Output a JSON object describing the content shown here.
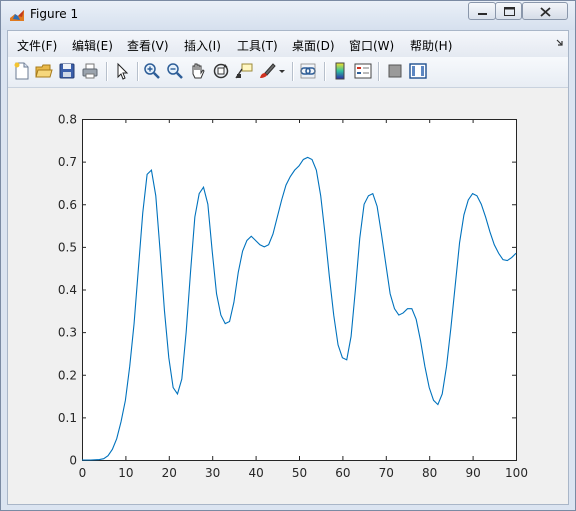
{
  "window": {
    "title": "Figure 1",
    "icon": "matlab-figure-icon",
    "controls": [
      "minimize-icon",
      "maximize-icon",
      "close-icon"
    ]
  },
  "menu": [
    {
      "label": "文件(F)"
    },
    {
      "label": "编辑(E)"
    },
    {
      "label": "查看(V)"
    },
    {
      "label": "插入(I)"
    },
    {
      "label": "工具(T)"
    },
    {
      "label": "桌面(D)"
    },
    {
      "label": "窗口(W)"
    },
    {
      "label": "帮助(H)"
    }
  ],
  "toolbar": [
    "new-figure-icon",
    "open-file-icon",
    "save-icon",
    "print-icon",
    "edit-plot-arrow-icon",
    "zoom-in-icon",
    "zoom-out-icon",
    "pan-hand-icon",
    "rotate-3d-icon",
    "data-cursor-icon",
    "brush-icon",
    "brush-dropdown-icon",
    "link-plot-icon",
    "insert-colorbar-icon",
    "insert-legend-icon",
    "hide-plot-tools-icon",
    "show-plot-tools-icon"
  ],
  "chart_data": {
    "type": "line",
    "title": "",
    "xlabel": "",
    "ylabel": "",
    "xlim": [
      0,
      100
    ],
    "ylim": [
      0,
      0.8
    ],
    "xticks": [
      "0",
      "10",
      "20",
      "30",
      "40",
      "50",
      "60",
      "70",
      "80",
      "90",
      "100"
    ],
    "yticks": [
      "0",
      "0.1",
      "0.2",
      "0.3",
      "0.4",
      "0.5",
      "0.6",
      "0.7",
      "0.8"
    ],
    "grid": false,
    "line_color": "#0072bd",
    "series": [
      {
        "values": [
          [
            0,
            0
          ],
          [
            2,
            0
          ],
          [
            4,
            0.001
          ],
          [
            5,
            0.003
          ],
          [
            6,
            0.01
          ],
          [
            7,
            0.025
          ],
          [
            8,
            0.05
          ],
          [
            9,
            0.09
          ],
          [
            10,
            0.14
          ],
          [
            11,
            0.22
          ],
          [
            12,
            0.32
          ],
          [
            13,
            0.45
          ],
          [
            14,
            0.58
          ],
          [
            15,
            0.67
          ],
          [
            16,
            0.68
          ],
          [
            17,
            0.62
          ],
          [
            18,
            0.49
          ],
          [
            19,
            0.35
          ],
          [
            20,
            0.24
          ],
          [
            21,
            0.17
          ],
          [
            22,
            0.155
          ],
          [
            23,
            0.19
          ],
          [
            24,
            0.3
          ],
          [
            25,
            0.44
          ],
          [
            26,
            0.57
          ],
          [
            27,
            0.625
          ],
          [
            28,
            0.64
          ],
          [
            29,
            0.6
          ],
          [
            30,
            0.49
          ],
          [
            31,
            0.39
          ],
          [
            32,
            0.34
          ],
          [
            33,
            0.32
          ],
          [
            34,
            0.325
          ],
          [
            35,
            0.37
          ],
          [
            36,
            0.44
          ],
          [
            37,
            0.49
          ],
          [
            38,
            0.515
          ],
          [
            39,
            0.525
          ],
          [
            40,
            0.515
          ],
          [
            41,
            0.505
          ],
          [
            42,
            0.5
          ],
          [
            43,
            0.505
          ],
          [
            44,
            0.53
          ],
          [
            45,
            0.57
          ],
          [
            46,
            0.61
          ],
          [
            47,
            0.645
          ],
          [
            48,
            0.665
          ],
          [
            49,
            0.68
          ],
          [
            50,
            0.69
          ],
          [
            51,
            0.705
          ],
          [
            52,
            0.71
          ],
          [
            53,
            0.705
          ],
          [
            54,
            0.68
          ],
          [
            55,
            0.62
          ],
          [
            56,
            0.53
          ],
          [
            57,
            0.43
          ],
          [
            58,
            0.34
          ],
          [
            59,
            0.27
          ],
          [
            60,
            0.24
          ],
          [
            61,
            0.235
          ],
          [
            62,
            0.29
          ],
          [
            63,
            0.4
          ],
          [
            64,
            0.52
          ],
          [
            65,
            0.6
          ],
          [
            66,
            0.62
          ],
          [
            67,
            0.625
          ],
          [
            68,
            0.595
          ],
          [
            69,
            0.53
          ],
          [
            70,
            0.46
          ],
          [
            71,
            0.39
          ],
          [
            72,
            0.355
          ],
          [
            73,
            0.34
          ],
          [
            74,
            0.345
          ],
          [
            75,
            0.355
          ],
          [
            76,
            0.355
          ],
          [
            77,
            0.33
          ],
          [
            78,
            0.28
          ],
          [
            79,
            0.22
          ],
          [
            80,
            0.17
          ],
          [
            81,
            0.14
          ],
          [
            82,
            0.13
          ],
          [
            83,
            0.155
          ],
          [
            84,
            0.22
          ],
          [
            85,
            0.31
          ],
          [
            86,
            0.41
          ],
          [
            87,
            0.51
          ],
          [
            88,
            0.575
          ],
          [
            89,
            0.61
          ],
          [
            90,
            0.625
          ],
          [
            91,
            0.62
          ],
          [
            92,
            0.6
          ],
          [
            93,
            0.57
          ],
          [
            94,
            0.535
          ],
          [
            95,
            0.505
          ],
          [
            96,
            0.485
          ],
          [
            97,
            0.47
          ],
          [
            98,
            0.468
          ],
          [
            99,
            0.475
          ],
          [
            100,
            0.485
          ]
        ]
      }
    ]
  }
}
